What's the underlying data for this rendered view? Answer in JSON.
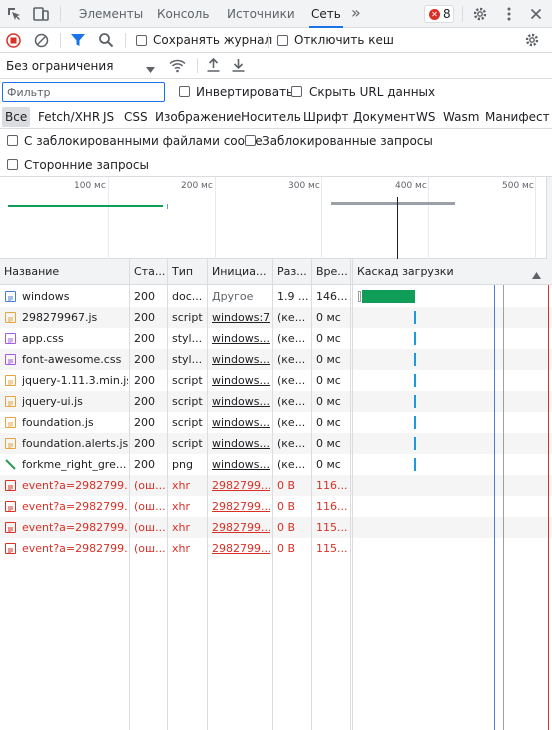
{
  "tabs": [
    "Элементы",
    "Консоль",
    "Источники",
    "Сеть"
  ],
  "more_tabs": "»",
  "error_count": "8",
  "toolbar": {
    "preserve_log": "Сохранять журнал",
    "disable_cache": "Отключить кеш",
    "throttling": "Без ограничения"
  },
  "filter": {
    "placeholder": "Фильтр",
    "invert": "Инвертировать",
    "hide_data_urls": "Скрыть URL данных"
  },
  "types": [
    "Все",
    "Fetch/XHR",
    "JS",
    "CSS",
    "Изображение",
    "Носитель",
    "Шрифт",
    "Документ",
    "WS",
    "Wasm",
    "Манифест"
  ],
  "options": {
    "blocked_cookies": "С заблокированными файлами cookie",
    "blocked_requests": "Заблокированные запросы",
    "third_party": "Сторонние запросы"
  },
  "overview_ticks": [
    "100 мс",
    "200 мс",
    "300 мс",
    "400 мс",
    "500 мс"
  ],
  "columns": [
    "Название",
    "Ста...",
    "Тип",
    "Инициа...",
    "Раз...",
    "Вре...",
    "Каскад загрузки"
  ],
  "rows": [
    {
      "name": "windows",
      "status": "200",
      "type": "doc...",
      "initiator": "Другое",
      "size": "1.9 ...",
      "time": "146...",
      "icon": "document-icon",
      "error": false
    },
    {
      "name": "298279967.js",
      "status": "200",
      "type": "script",
      "initiator": "windows:7",
      "size": "(ке...",
      "time": "0 мс",
      "icon": "script-icon",
      "error": false
    },
    {
      "name": "app.css",
      "status": "200",
      "type": "styl...",
      "initiator": "windows...",
      "size": "(ке...",
      "time": "0 мс",
      "icon": "stylesheet-icon",
      "error": false
    },
    {
      "name": "font-awesome.css",
      "status": "200",
      "type": "styl...",
      "initiator": "windows...",
      "size": "(ке...",
      "time": "0 мс",
      "icon": "stylesheet-icon",
      "error": false
    },
    {
      "name": "jquery-1.11.3.min.js",
      "status": "200",
      "type": "script",
      "initiator": "windows...",
      "size": "(ке...",
      "time": "0 мс",
      "icon": "script-icon",
      "error": false
    },
    {
      "name": "jquery-ui.js",
      "status": "200",
      "type": "script",
      "initiator": "windows...",
      "size": "(ке...",
      "time": "0 мс",
      "icon": "script-icon",
      "error": false
    },
    {
      "name": "foundation.js",
      "status": "200",
      "type": "script",
      "initiator": "windows...",
      "size": "(ке...",
      "time": "0 мс",
      "icon": "script-icon",
      "error": false
    },
    {
      "name": "foundation.alerts.js",
      "status": "200",
      "type": "script",
      "initiator": "windows...",
      "size": "(ке...",
      "time": "0 мс",
      "icon": "script-icon",
      "error": false
    },
    {
      "name": "forkme_right_gre...",
      "status": "200",
      "type": "png",
      "initiator": "windows...",
      "size": "(ке...",
      "time": "0 мс",
      "icon": "image-icon",
      "error": false
    },
    {
      "name": "event?a=2982799...",
      "status": "(ош...",
      "type": "xhr",
      "initiator": "2982799...",
      "size": "0 B",
      "time": "116...",
      "icon": "xhr-icon",
      "error": true
    },
    {
      "name": "event?a=2982799...",
      "status": "(ош...",
      "type": "xhr",
      "initiator": "2982799...",
      "size": "0 B",
      "time": "116...",
      "icon": "xhr-icon",
      "error": true
    },
    {
      "name": "event?a=2982799...",
      "status": "(ош...",
      "type": "xhr",
      "initiator": "2982799...",
      "size": "0 B",
      "time": "115...",
      "icon": "xhr-icon",
      "error": true
    },
    {
      "name": "event?a=2982799...",
      "status": "(ош...",
      "type": "xhr",
      "initiator": "2982799...",
      "size": "0 B",
      "time": "115...",
      "icon": "xhr-icon",
      "error": true
    }
  ],
  "colors": {
    "accent": "#1a73e8",
    "error": "#d93025",
    "waterfall_green": "#0f9d58",
    "document_icon": "#4a7dd8",
    "script_icon": "#e8a33d",
    "stylesheet_icon": "#a25ce0",
    "image_icon": "#2e9a58"
  }
}
